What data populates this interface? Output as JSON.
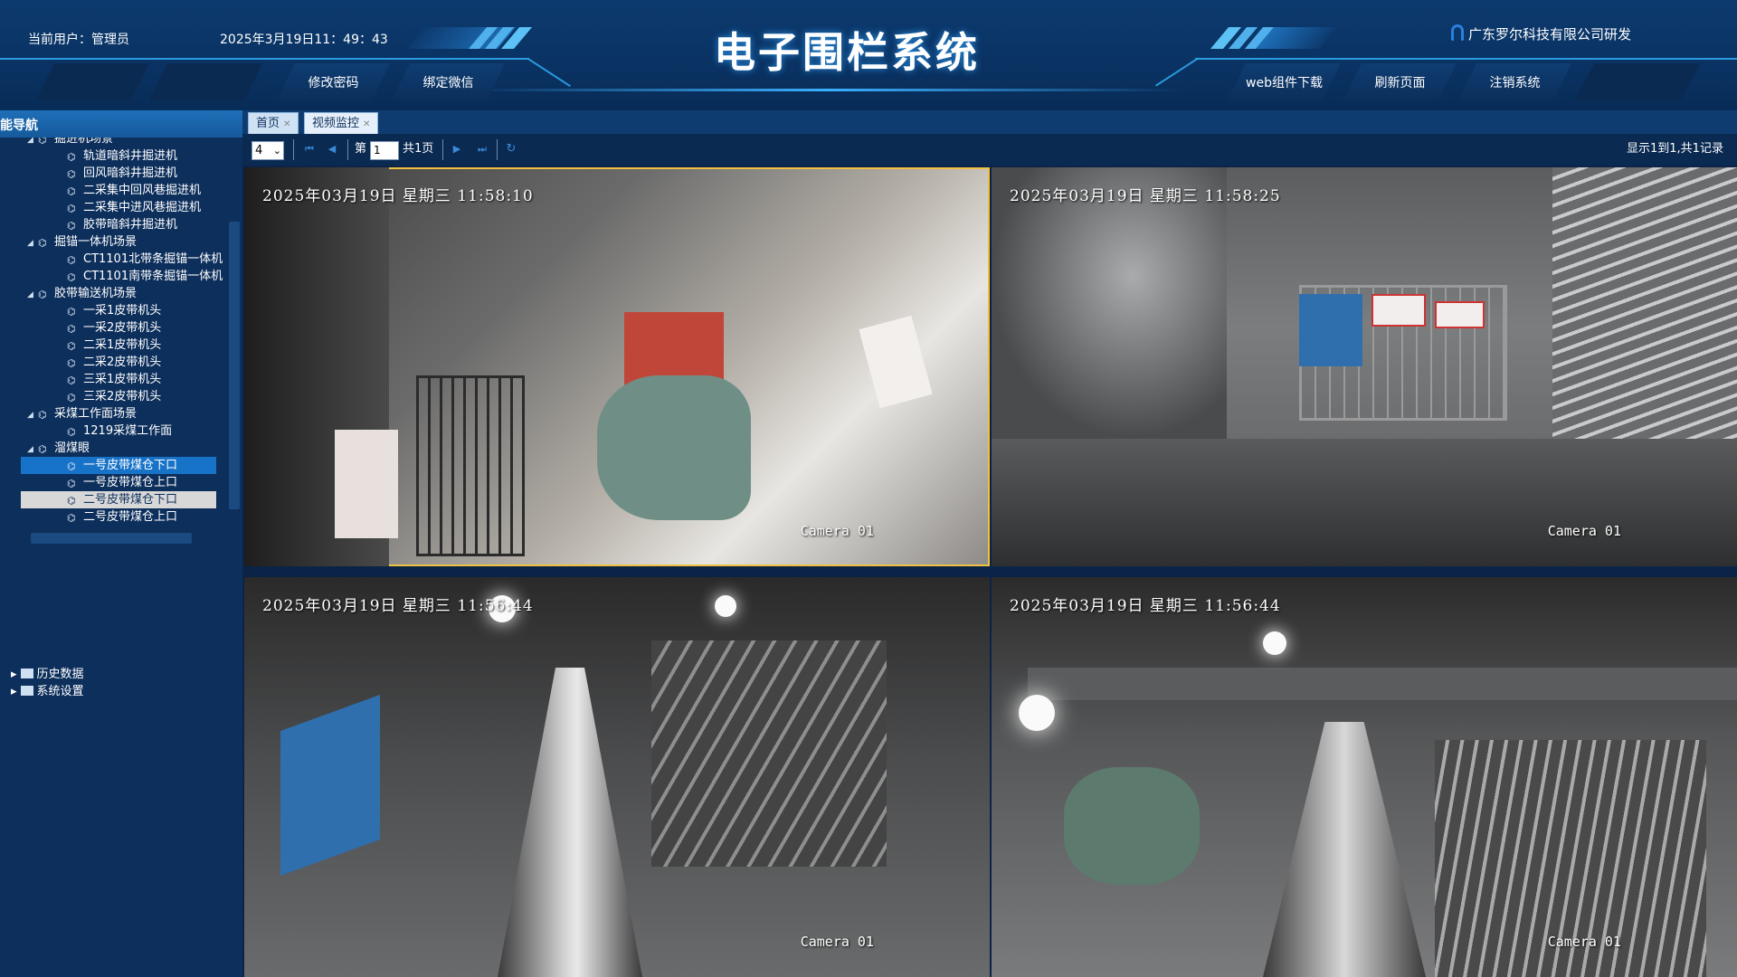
{
  "header": {
    "user_label": "当前用户：管理员",
    "datetime": "2025年3月19日11：49：43",
    "title": "电子围栏系统",
    "company": "广东罗尔科技有限公司研发",
    "nav_left": [
      "修改密码",
      "绑定微信"
    ],
    "nav_right": [
      "web组件下载",
      "刷新页面",
      "注销系统"
    ]
  },
  "sidebar": {
    "title": "功能导航",
    "partial_top": "掘进机场景",
    "tree": [
      {
        "label": "轨道暗斜井掘进机",
        "level": 2
      },
      {
        "label": "回风暗斜井掘进机",
        "level": 2
      },
      {
        "label": "二采集中回风巷掘进机",
        "level": 2
      },
      {
        "label": "二采集中进风巷掘进机",
        "level": 2
      },
      {
        "label": "胶带暗斜井掘进机",
        "level": 2
      },
      {
        "label": "掘锚一体机场景",
        "level": 1
      },
      {
        "label": "CT1101北带条掘锚一体机",
        "level": 2
      },
      {
        "label": "CT1101南带条掘锚一体机",
        "level": 2
      },
      {
        "label": "胶带输送机场景",
        "level": 1
      },
      {
        "label": "一采1皮带机头",
        "level": 2
      },
      {
        "label": "一采2皮带机头",
        "level": 2
      },
      {
        "label": "二采1皮带机头",
        "level": 2
      },
      {
        "label": "二采2皮带机头",
        "level": 2
      },
      {
        "label": "三采1皮带机头",
        "level": 2
      },
      {
        "label": "三采2皮带机头",
        "level": 2
      },
      {
        "label": "采煤工作面场景",
        "level": 1
      },
      {
        "label": "1219采煤工作面",
        "level": 2
      },
      {
        "label": "溜煤眼",
        "level": 1
      },
      {
        "label": "一号皮带煤仓下口",
        "level": 2,
        "state": "selected"
      },
      {
        "label": "一号皮带煤仓上口",
        "level": 2
      },
      {
        "label": "二号皮带煤仓下口",
        "level": 2,
        "state": "hover"
      },
      {
        "label": "二号皮带煤仓上口",
        "level": 2
      }
    ],
    "roots": [
      "历史数据",
      "系统设置"
    ]
  },
  "tabs": [
    {
      "label": "首页"
    },
    {
      "label": "视频监控",
      "active": true
    }
  ],
  "toolbar": {
    "page_size": "4",
    "page_prefix": "第",
    "page_value": "1",
    "page_total": "共1页",
    "record_info": "显示1到1,共1记录"
  },
  "cameras": [
    {
      "timestamp": "2025年03月19日  星期三  11:58:10",
      "label": "Camera 01"
    },
    {
      "timestamp": "2025年03月19日  星期三  11:58:25",
      "label": "Camera 01"
    },
    {
      "timestamp": "2025年03月19日  星期三  11:56:44",
      "label": "Camera 01"
    },
    {
      "timestamp": "2025年03月19日  星期三  11:56:44",
      "label": "Camera 01"
    }
  ],
  "colors": {
    "header_bg": "#0a3364",
    "sidebar_bg": "#0d2f5c",
    "selected": "#1773c8",
    "active_frame": "#f0c040"
  }
}
